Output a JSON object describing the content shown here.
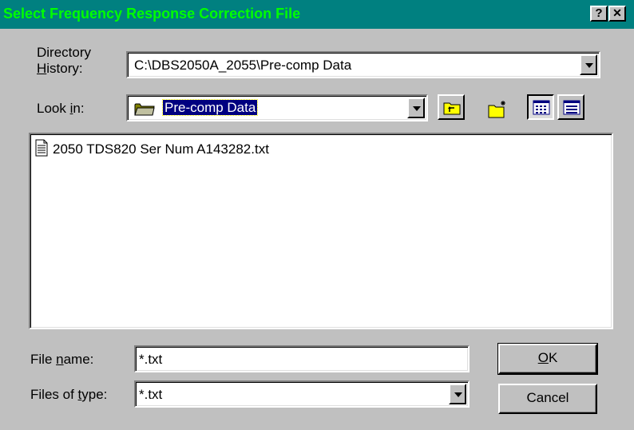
{
  "window": {
    "title": "Select Frequency Response Correction File",
    "help_button": "?",
    "close_button": "✕"
  },
  "directory_history": {
    "label_line1": "Directory",
    "label_line2_pre": "",
    "label_line2_underline": "H",
    "label_line2_post": "istory:",
    "value": "C:\\DBS2050A_2055\\Pre-comp Data"
  },
  "look_in": {
    "label_pre": "Look ",
    "label_underline": "i",
    "label_post": "n:",
    "value": "Pre-comp Data"
  },
  "toolbar": {
    "up_one_level": "up-folder-icon",
    "new_folder": "new-folder-icon",
    "list_view": "list-view-icon",
    "details_view": "details-view-icon"
  },
  "files": [
    {
      "name": "2050 TDS820 Ser  Num A143282.txt",
      "icon": "text-file-icon"
    }
  ],
  "file_name": {
    "label_pre": "File ",
    "label_underline": "n",
    "label_post": "ame:",
    "value": "*.txt"
  },
  "file_type": {
    "label_pre": "Files of ",
    "label_underline": "t",
    "label_post": "ype:",
    "value": "*.txt"
  },
  "buttons": {
    "ok_underline": "O",
    "ok_rest": "K",
    "cancel": "Cancel"
  },
  "colors": {
    "titlebar": "#008080",
    "title_text": "#00ff00",
    "face": "#c0c0c0",
    "selection": "#000080"
  }
}
